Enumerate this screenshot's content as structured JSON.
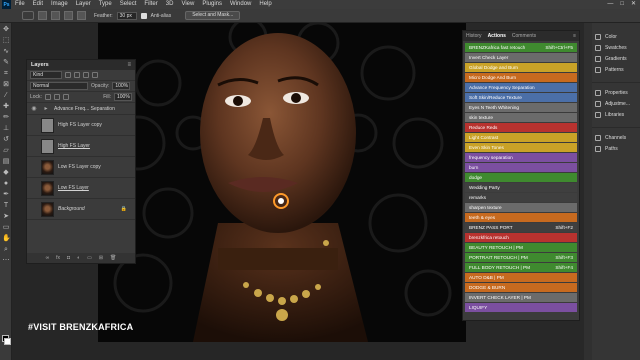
{
  "menubar": {
    "logo": "Ps",
    "items": [
      "File",
      "Edit",
      "Image",
      "Layer",
      "Type",
      "Select",
      "Filter",
      "3D",
      "View",
      "Plugins",
      "Window",
      "Help"
    ],
    "window_controls": [
      "—",
      "□",
      "✕"
    ]
  },
  "options_bar": {
    "feather_label": "Feather:",
    "feather_value": "30 px",
    "antialias_label": "Anti-alias",
    "select_mask_label": "Select and Mask..."
  },
  "layers_panel": {
    "title": "Layers",
    "filter_kind": "Kind",
    "blend_mode": "Normal",
    "opacity_label": "Opacity:",
    "opacity_value": "100%",
    "lock_label": "Lock:",
    "fill_label": "Fill:",
    "fill_value": "100%",
    "layers": [
      {
        "name": "Advance Freq... Separation",
        "type": "group"
      },
      {
        "name": "High FS Layer copy",
        "type": "layer",
        "thumb": "gray"
      },
      {
        "name": "High FS Layer",
        "type": "layer",
        "thumb": "gray"
      },
      {
        "name": "Low FS Layer copy",
        "type": "layer",
        "thumb": "face"
      },
      {
        "name": "Low FS Layer",
        "type": "layer",
        "thumb": "face"
      },
      {
        "name": "Background",
        "type": "layer",
        "thumb": "face",
        "locked": true
      }
    ],
    "footer_icons": [
      "link-icon",
      "fx-icon",
      "mask-icon",
      "adjustment-icon",
      "folder-icon",
      "new-layer-icon",
      "trash-icon"
    ]
  },
  "actions_panel": {
    "tabs": [
      "History",
      "Actions",
      "Comments"
    ],
    "active_tab": "Actions",
    "items": [
      {
        "label": "BRENZKafrica fast retouch",
        "shortcut": "Shift+Ctrl+F5",
        "color": "#3f8a2f"
      },
      {
        "label": "Invert Check Layer",
        "shortcut": "",
        "color": "#6b6b6b"
      },
      {
        "label": "Global Dodge and Burn",
        "shortcut": "",
        "color": "#c9a227"
      },
      {
        "label": "Micro Dodge And Burn",
        "shortcut": "",
        "color": "#c76a1f"
      },
      {
        "label": "Advance Frequency Separation",
        "shortcut": "",
        "color": "#4b6fa8"
      },
      {
        "label": "Soft Skin/Reduce Texture",
        "shortcut": "",
        "color": "#4b6fa8"
      },
      {
        "label": "Eyes N Teeth Whitening",
        "shortcut": "",
        "color": "#6b6b6b"
      },
      {
        "label": "skin texture",
        "shortcut": "",
        "color": "#6b6b6b"
      },
      {
        "label": "Reduce Reds",
        "shortcut": "",
        "color": "#b8322f"
      },
      {
        "label": "Light Contrast",
        "shortcut": "",
        "color": "#c9a227"
      },
      {
        "label": "Even Skin Tones",
        "shortcut": "",
        "color": "#c9a227"
      },
      {
        "label": "frequency separation",
        "shortcut": "",
        "color": "#7b4fa0"
      },
      {
        "label": "burn",
        "shortcut": "",
        "color": "#7b4fa0"
      },
      {
        "label": "dodge",
        "shortcut": "",
        "color": "#3f8a2f"
      },
      {
        "label": "Wedding Party",
        "shortcut": "",
        "color": "#3f3f3f"
      },
      {
        "label": "remarks",
        "shortcut": "",
        "color": "#3f3f3f"
      },
      {
        "label": "sharpen texture",
        "shortcut": "",
        "color": "#6b6b6b"
      },
      {
        "label": "teeth & eyes",
        "shortcut": "",
        "color": "#c76a1f"
      },
      {
        "label": "BRENZ PASS PORT",
        "shortcut": "Shift+F2",
        "color": "#3f3f3f"
      },
      {
        "label": "brenzkfrica retouch",
        "shortcut": "",
        "color": "#b8322f"
      },
      {
        "label": "BEAUTY RETOUCH | PM",
        "shortcut": "",
        "color": "#3f8a2f"
      },
      {
        "label": "PORTRAIT RETOUCH | PM",
        "shortcut": "Shift+F3",
        "color": "#3f8a2f"
      },
      {
        "label": "FULL BODY RETOUCH | PM",
        "shortcut": "Shift+F4",
        "color": "#3f8a2f"
      },
      {
        "label": "AUTO D&B | PM",
        "shortcut": "",
        "color": "#c76a1f"
      },
      {
        "label": "DODGE & BURN",
        "shortcut": "",
        "color": "#c76a1f"
      },
      {
        "label": "INVERT CHECK LAYER | PM",
        "shortcut": "",
        "color": "#6b6b6b"
      },
      {
        "label": "LIQUIFY",
        "shortcut": "",
        "color": "#7b4fa0"
      }
    ]
  },
  "right_dock": {
    "group1": [
      {
        "label": "Color",
        "icon": "color-icon"
      },
      {
        "label": "Swatches",
        "icon": "swatches-icon"
      },
      {
        "label": "Gradients",
        "icon": "gradients-icon"
      },
      {
        "label": "Patterns",
        "icon": "patterns-icon"
      }
    ],
    "group2": [
      {
        "label": "Properties",
        "icon": "properties-icon"
      },
      {
        "label": "Adjustme...",
        "icon": "adjustments-icon"
      },
      {
        "label": "Libraries",
        "icon": "libraries-icon"
      }
    ],
    "group3": [
      {
        "label": "Channels",
        "icon": "channels-icon"
      },
      {
        "label": "Paths",
        "icon": "paths-icon"
      }
    ]
  },
  "watermark": "#VISIT BRENZKAFRICA"
}
